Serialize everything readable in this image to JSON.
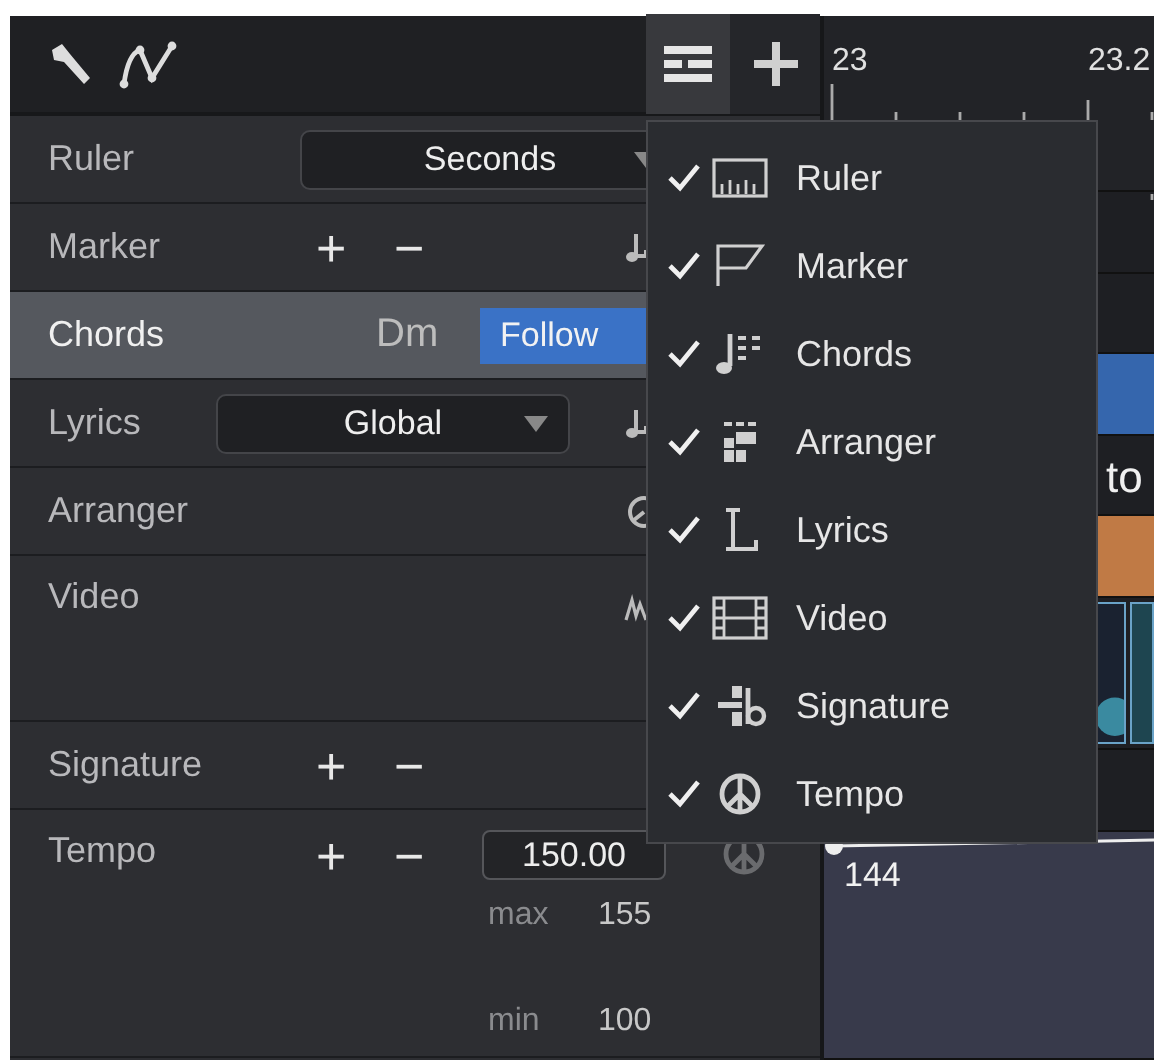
{
  "tracks": [
    {
      "kind": "ruler",
      "label": "Ruler",
      "selected": false,
      "dropdown": "Seconds"
    },
    {
      "kind": "marker",
      "label": "Marker",
      "selected": false,
      "add": "+",
      "remove": "−"
    },
    {
      "kind": "chords",
      "label": "Chords",
      "selected": true,
      "chord": "Dm",
      "follow": "Follow"
    },
    {
      "kind": "lyrics",
      "label": "Lyrics",
      "selected": false,
      "dropdown": "Global"
    },
    {
      "kind": "arranger",
      "label": "Arranger",
      "selected": false
    },
    {
      "kind": "video",
      "label": "Video",
      "selected": false
    },
    {
      "kind": "signature",
      "label": "Signature",
      "selected": false,
      "add": "+",
      "remove": "−"
    },
    {
      "kind": "tempo",
      "label": "Tempo",
      "selected": false,
      "add": "+",
      "remove": "−",
      "value": "150.00",
      "max_label": "max",
      "max": "155",
      "min_label": "min",
      "min": "100"
    }
  ],
  "menu": {
    "items": [
      {
        "kind": "ruler",
        "label": "Ruler",
        "checked": true
      },
      {
        "kind": "marker",
        "label": "Marker",
        "checked": true
      },
      {
        "kind": "chords",
        "label": "Chords",
        "checked": true
      },
      {
        "kind": "arranger",
        "label": "Arranger",
        "checked": true
      },
      {
        "kind": "lyrics",
        "label": "Lyrics",
        "checked": true
      },
      {
        "kind": "video",
        "label": "Video",
        "checked": true
      },
      {
        "kind": "signature",
        "label": "Signature",
        "checked": true
      },
      {
        "kind": "tempo",
        "label": "Tempo",
        "checked": true
      }
    ]
  },
  "timeline": {
    "ruler_labels": [
      "23",
      "23.2"
    ],
    "lyric_text": "to",
    "tempo_value": "144"
  }
}
